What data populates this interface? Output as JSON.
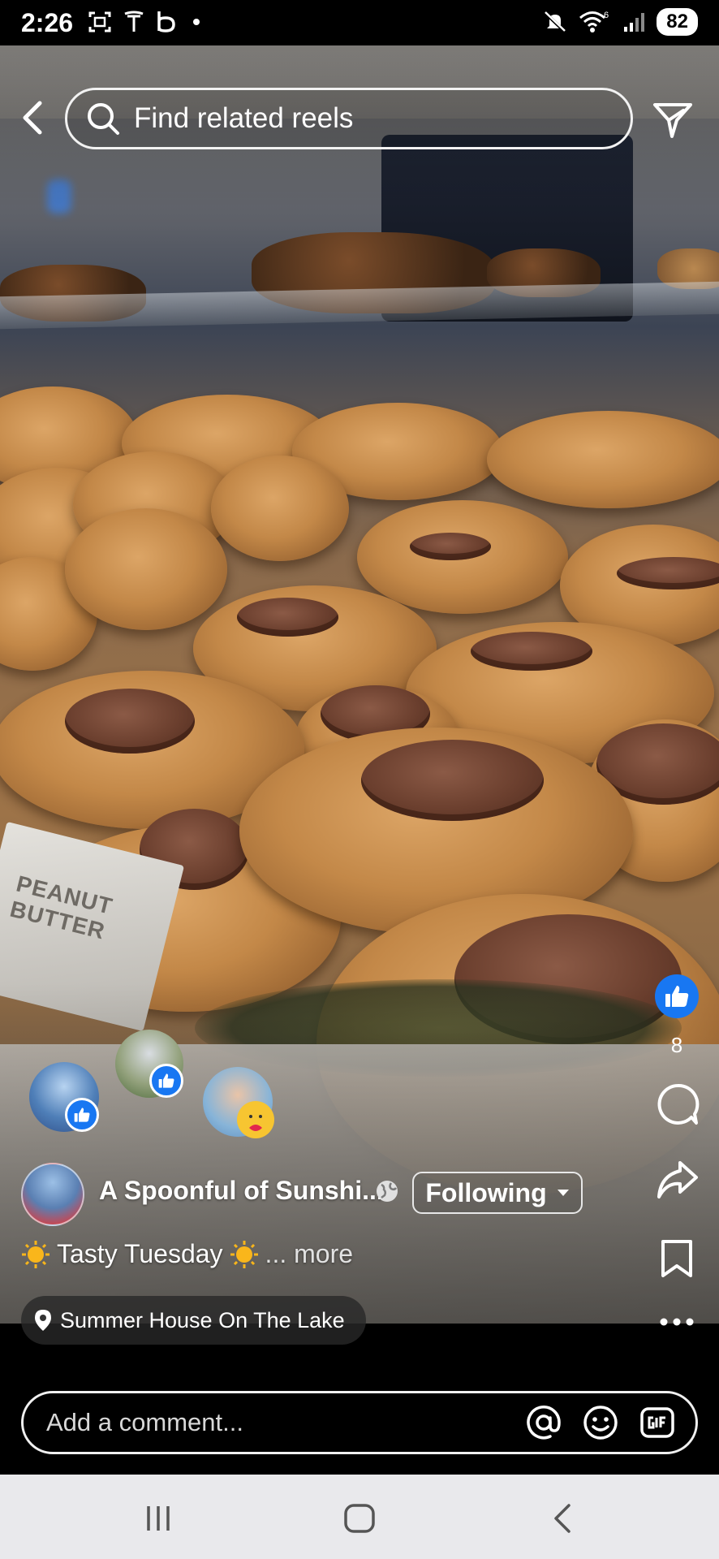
{
  "status_bar": {
    "time": "2:26",
    "battery": "82",
    "signal_label": "6"
  },
  "top_bar": {
    "search_placeholder": "Find related reels"
  },
  "actions": {
    "like_count": "8"
  },
  "post": {
    "author_name": "A Spoonful of Sunshi...",
    "follow_label": "Following",
    "caption_text": "Tasty Tuesday",
    "caption_more": "... more",
    "location": "Summer House On The Lake"
  },
  "comment": {
    "placeholder": "Add a comment..."
  },
  "colors": {
    "facebook_blue": "#1877f2",
    "background": "#000000",
    "navbar": "#e9e9ec"
  }
}
